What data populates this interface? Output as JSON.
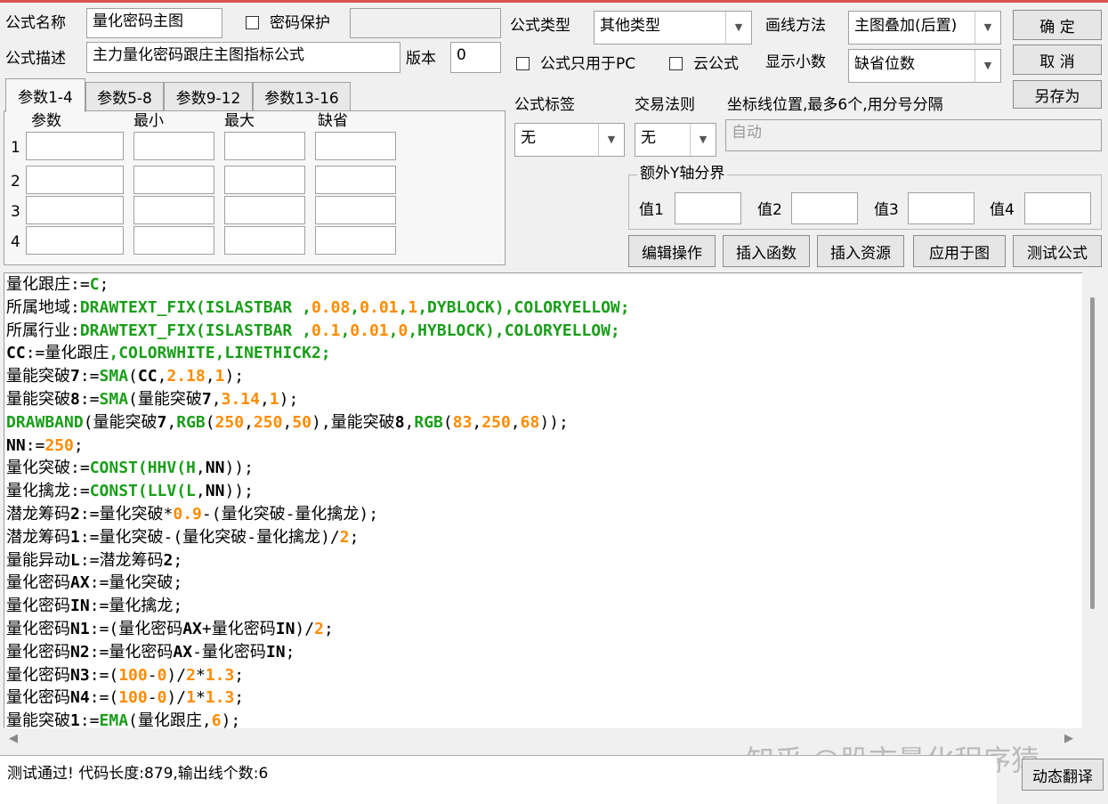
{
  "header": {
    "name_label": "公式名称",
    "name_value": "量化密码主图",
    "password_label": "密码保护",
    "password_value": "",
    "desc_label": "公式描述",
    "desc_value": "主力量化密码跟庄主图指标公式",
    "version_label": "版本",
    "version_value": "0",
    "type_label": "公式类型",
    "type_value": "其他类型",
    "draw_label": "画线方法",
    "draw_value": "主图叠加(后置)",
    "pc_only_label": "公式只用于PC",
    "cloud_label": "云公式",
    "decimals_label": "显示小数",
    "decimals_value": "缺省位数"
  },
  "buttons": {
    "ok": "确  定",
    "cancel": "取  消",
    "save_as": "另存为",
    "edit_ops": "编辑操作",
    "insert_func": "插入函数",
    "insert_res": "插入资源",
    "apply_chart": "应用于图",
    "test_formula": "测试公式",
    "dynamic_translate": "动态翻译"
  },
  "params": {
    "tabs": [
      "参数1-4",
      "参数5-8",
      "参数9-12",
      "参数13-16"
    ],
    "columns": [
      "参数",
      "最小",
      "最大",
      "缺省"
    ],
    "rows": [
      "1",
      "2",
      "3",
      "4"
    ]
  },
  "right": {
    "tag_label": "公式标签",
    "tag_value": "无",
    "rule_label": "交易法则",
    "rule_value": "无",
    "coord_label": "坐标线位置,最多6个,用分号分隔",
    "coord_value": "自动",
    "yaxis_group": "额外Y轴分界",
    "yvals": [
      "值1",
      "值2",
      "值3",
      "值4"
    ]
  },
  "code_lines": [
    [
      [
        "id",
        "量化跟庄"
      ],
      [
        "op",
        ":="
      ],
      [
        "fn",
        "C"
      ],
      [
        "op",
        ";"
      ]
    ],
    [
      [
        "id",
        "所属地域"
      ],
      [
        "op",
        ":"
      ],
      [
        "fn",
        "DRAWTEXT_FIX(ISLASTBAR ,"
      ],
      [
        "num",
        "0.08"
      ],
      [
        "fn",
        ","
      ],
      [
        "num",
        "0.01"
      ],
      [
        "fn",
        ","
      ],
      [
        "num",
        "1"
      ],
      [
        "fn",
        ",DYBLOCK),COLORYELLOW;"
      ]
    ],
    [
      [
        "id",
        "所属行业"
      ],
      [
        "op",
        ":"
      ],
      [
        "fn",
        "DRAWTEXT_FIX(ISLASTBAR ,"
      ],
      [
        "num",
        "0.1"
      ],
      [
        "fn",
        ","
      ],
      [
        "num",
        "0.01"
      ],
      [
        "fn",
        ","
      ],
      [
        "num",
        "0"
      ],
      [
        "fn",
        ",HYBLOCK),COLORYELLOW;"
      ]
    ],
    [
      [
        "idl",
        "CC"
      ],
      [
        "op",
        ":="
      ],
      [
        "id",
        "量化跟庄"
      ],
      [
        "fn",
        ",COLORWHITE,LINETHICK2;"
      ]
    ],
    [
      [
        "id",
        "量能突破"
      ],
      [
        "idl",
        "7"
      ],
      [
        "op",
        ":="
      ],
      [
        "fn",
        "SMA"
      ],
      [
        "op",
        "("
      ],
      [
        "idl",
        "CC"
      ],
      [
        "op",
        ","
      ],
      [
        "num",
        "2.18"
      ],
      [
        "op",
        ","
      ],
      [
        "num",
        "1"
      ],
      [
        "op",
        ");"
      ]
    ],
    [
      [
        "id",
        "量能突破"
      ],
      [
        "idl",
        "8"
      ],
      [
        "op",
        ":="
      ],
      [
        "fn",
        "SMA"
      ],
      [
        "op",
        "("
      ],
      [
        "id",
        "量能突破"
      ],
      [
        "idl",
        "7"
      ],
      [
        "op",
        ","
      ],
      [
        "num",
        "3.14"
      ],
      [
        "op",
        ","
      ],
      [
        "num",
        "1"
      ],
      [
        "op",
        ");"
      ]
    ],
    [
      [
        "fn",
        "DRAWBAND"
      ],
      [
        "op",
        "("
      ],
      [
        "id",
        "量能突破"
      ],
      [
        "idl",
        "7"
      ],
      [
        "op",
        ","
      ],
      [
        "fn",
        "RGB"
      ],
      [
        "op",
        "("
      ],
      [
        "num",
        "250"
      ],
      [
        "op",
        ","
      ],
      [
        "num",
        "250"
      ],
      [
        "op",
        ","
      ],
      [
        "num",
        "50"
      ],
      [
        "op",
        "),"
      ],
      [
        "id",
        "量能突破"
      ],
      [
        "idl",
        "8"
      ],
      [
        "op",
        ","
      ],
      [
        "fn",
        "RGB"
      ],
      [
        "op",
        "("
      ],
      [
        "num",
        "83"
      ],
      [
        "op",
        ","
      ],
      [
        "num",
        "250"
      ],
      [
        "op",
        ","
      ],
      [
        "num",
        "68"
      ],
      [
        "op",
        "));"
      ]
    ],
    [
      [
        "idl",
        "NN"
      ],
      [
        "op",
        ":="
      ],
      [
        "num",
        "250"
      ],
      [
        "op",
        ";"
      ]
    ],
    [
      [
        "id",
        "量化突破"
      ],
      [
        "op",
        ":="
      ],
      [
        "fn",
        "CONST(HHV(H"
      ],
      [
        "op",
        ","
      ],
      [
        "idl",
        "NN"
      ],
      [
        "op",
        "));"
      ]
    ],
    [
      [
        "id",
        "量化擒龙"
      ],
      [
        "op",
        ":="
      ],
      [
        "fn",
        "CONST(LLV(L"
      ],
      [
        "op",
        ","
      ],
      [
        "idl",
        "NN"
      ],
      [
        "op",
        "));"
      ]
    ],
    [
      [
        "id",
        "潜龙筹码"
      ],
      [
        "idl",
        "2"
      ],
      [
        "op",
        ":="
      ],
      [
        "id",
        "量化突破"
      ],
      [
        "op",
        "*"
      ],
      [
        "num",
        "0.9"
      ],
      [
        "op",
        "-("
      ],
      [
        "id",
        "量化突破"
      ],
      [
        "op",
        "-"
      ],
      [
        "id",
        "量化擒龙"
      ],
      [
        "op",
        ");"
      ]
    ],
    [
      [
        "id",
        "潜龙筹码"
      ],
      [
        "idl",
        "1"
      ],
      [
        "op",
        ":="
      ],
      [
        "id",
        "量化突破"
      ],
      [
        "op",
        "-("
      ],
      [
        "id",
        "量化突破"
      ],
      [
        "op",
        "-"
      ],
      [
        "id",
        "量化擒龙"
      ],
      [
        "op",
        ")/"
      ],
      [
        "num",
        "2"
      ],
      [
        "op",
        ";"
      ]
    ],
    [
      [
        "id",
        "量能异动"
      ],
      [
        "idl",
        "L"
      ],
      [
        "op",
        ":="
      ],
      [
        "id",
        "潜龙筹码"
      ],
      [
        "idl",
        "2"
      ],
      [
        "op",
        ";"
      ]
    ],
    [
      [
        "id",
        "量化密码"
      ],
      [
        "idl",
        "AX"
      ],
      [
        "op",
        ":="
      ],
      [
        "id",
        "量化突破"
      ],
      [
        "op",
        ";"
      ]
    ],
    [
      [
        "id",
        "量化密码"
      ],
      [
        "idl",
        "IN"
      ],
      [
        "op",
        ":="
      ],
      [
        "id",
        "量化擒龙"
      ],
      [
        "op",
        ";"
      ]
    ],
    [
      [
        "id",
        "量化密码"
      ],
      [
        "idl",
        "N1"
      ],
      [
        "op",
        ":=("
      ],
      [
        "id",
        "量化密码"
      ],
      [
        "idl",
        "AX"
      ],
      [
        "op",
        "+"
      ],
      [
        "id",
        "量化密码"
      ],
      [
        "idl",
        "IN"
      ],
      [
        "op",
        ")/"
      ],
      [
        "num",
        "2"
      ],
      [
        "op",
        ";"
      ]
    ],
    [
      [
        "id",
        "量化密码"
      ],
      [
        "idl",
        "N2"
      ],
      [
        "op",
        ":="
      ],
      [
        "id",
        "量化密码"
      ],
      [
        "idl",
        "AX"
      ],
      [
        "op",
        "-"
      ],
      [
        "id",
        "量化密码"
      ],
      [
        "idl",
        "IN"
      ],
      [
        "op",
        ";"
      ]
    ],
    [
      [
        "id",
        "量化密码"
      ],
      [
        "idl",
        "N3"
      ],
      [
        "op",
        ":=("
      ],
      [
        "num",
        "100"
      ],
      [
        "op",
        "-"
      ],
      [
        "num",
        "0"
      ],
      [
        "op",
        ")/"
      ],
      [
        "num",
        "2"
      ],
      [
        "op",
        "*"
      ],
      [
        "num",
        "1.3"
      ],
      [
        "op",
        ";"
      ]
    ],
    [
      [
        "id",
        "量化密码"
      ],
      [
        "idl",
        "N4"
      ],
      [
        "op",
        ":=("
      ],
      [
        "num",
        "100"
      ],
      [
        "op",
        "-"
      ],
      [
        "num",
        "0"
      ],
      [
        "op",
        ")/"
      ],
      [
        "num",
        "1"
      ],
      [
        "op",
        "*"
      ],
      [
        "num",
        "1.3"
      ],
      [
        "op",
        ";"
      ]
    ],
    [
      [
        "id",
        "量能突破"
      ],
      [
        "idl",
        "1"
      ],
      [
        "op",
        ":="
      ],
      [
        "fn",
        "EMA"
      ],
      [
        "op",
        "("
      ],
      [
        "id",
        "量化跟庄"
      ],
      [
        "op",
        ","
      ],
      [
        "num",
        "6"
      ],
      [
        "op",
        ");"
      ]
    ]
  ],
  "status": {
    "message": "测试通过! 代码长度:879,输出线个数:6"
  },
  "watermark": "知乎 @股市量化程序猿"
}
